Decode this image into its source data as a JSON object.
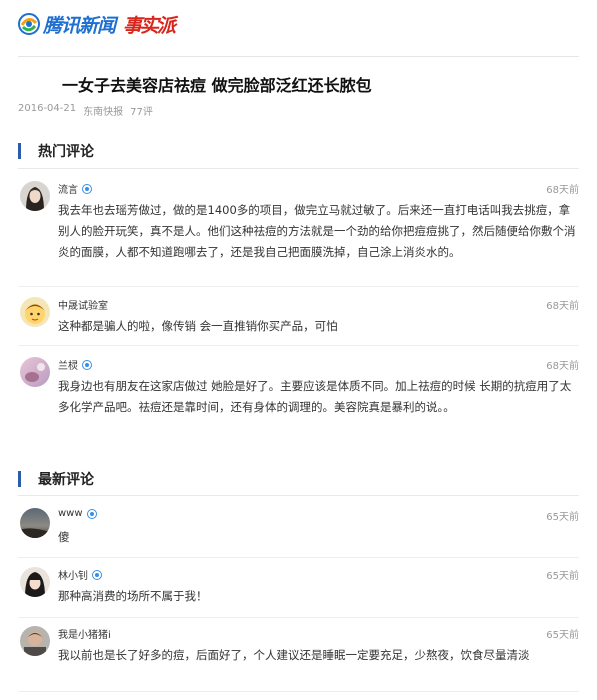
{
  "header": {
    "logo_text": "腾讯新闻",
    "logo_sub": "事实派"
  },
  "article": {
    "title": "一女子去美容店祛痘 做完脸部泛红还长脓包",
    "date": "2016-04-21",
    "source": "东南快报",
    "comment_count": "77评"
  },
  "hot": {
    "title": "热门评论",
    "comments": [
      {
        "user": "流言",
        "verified": true,
        "time": "68天前",
        "text": "我去年也去瑶芳做过，做的是1400多的项目，做完立马就过敏了。后来还一直打电话叫我去挑痘，拿别人的脸开玩笑，真不是人。他们这种祛痘的方法就是一个劲的给你把痘痘挑了，然后随便给你敷个消炎的面膜，人都不知道跑哪去了，还是我自己把面膜洗掉，自己涂上消炎水的。"
      },
      {
        "user": "中晟试验室",
        "verified": false,
        "time": "68天前",
        "text": "这种都是骗人的啦，像传销 会一直推销你买产品，可怕"
      },
      {
        "user": "兰棂",
        "verified": true,
        "time": "68天前",
        "text": "我身边也有朋友在这家店做过 她脸是好了。主要应该是体质不同。加上祛痘的时候 长期的抗痘用了太多化学产品吧。祛痘还是靠时间，还有身体的调理的。美容院真是暴利的说。。"
      }
    ]
  },
  "latest": {
    "title": "最新评论",
    "comments": [
      {
        "user": "www",
        "verified": true,
        "time": "65天前",
        "text": "傻"
      },
      {
        "user": "林小钊",
        "verified": true,
        "time": "65天前",
        "text": "那种高消费的场所不属于我！"
      },
      {
        "user": "我是小猪猪i",
        "verified": false,
        "time": "65天前",
        "text": "我以前也是长了好多的痘，后面好了，个人建议还是睡眠一定要充足，少熬夜，饮食尽量清淡"
      }
    ]
  }
}
